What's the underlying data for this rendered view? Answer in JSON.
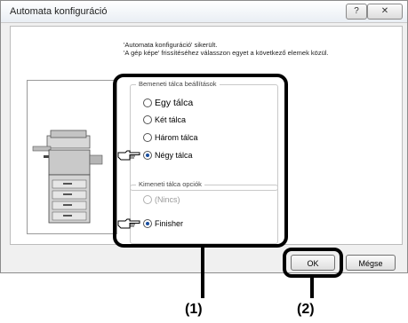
{
  "window": {
    "title": "Automata konfiguráció",
    "help_label": "?",
    "close_label": "✕"
  },
  "message": {
    "line1": "'Automata konfiguráció' sikerült.",
    "line2": "'A gép képe' frissítéséhez válasszon egyet a következő elemek közül."
  },
  "input_tray": {
    "legend": "Bemeneti tálca beállítások",
    "options": [
      {
        "label": "Egy tálca",
        "checked": false
      },
      {
        "label": "Két tálca",
        "checked": false
      },
      {
        "label": "Három tálca",
        "checked": false
      },
      {
        "label": "Négy tálca",
        "checked": true
      }
    ]
  },
  "output_tray": {
    "legend": "Kimeneti tálca opciók",
    "options": [
      {
        "label": "(Nincs)",
        "checked": false,
        "disabled": true
      },
      {
        "label": "Finisher",
        "checked": true,
        "disabled": false
      }
    ]
  },
  "buttons": {
    "ok": "OK",
    "cancel": "Mégse"
  },
  "callouts": {
    "c1": "(1)",
    "c2": "(2)"
  },
  "icons": {
    "pointer": "pointing-hand-icon",
    "printer": "printer-icon"
  }
}
